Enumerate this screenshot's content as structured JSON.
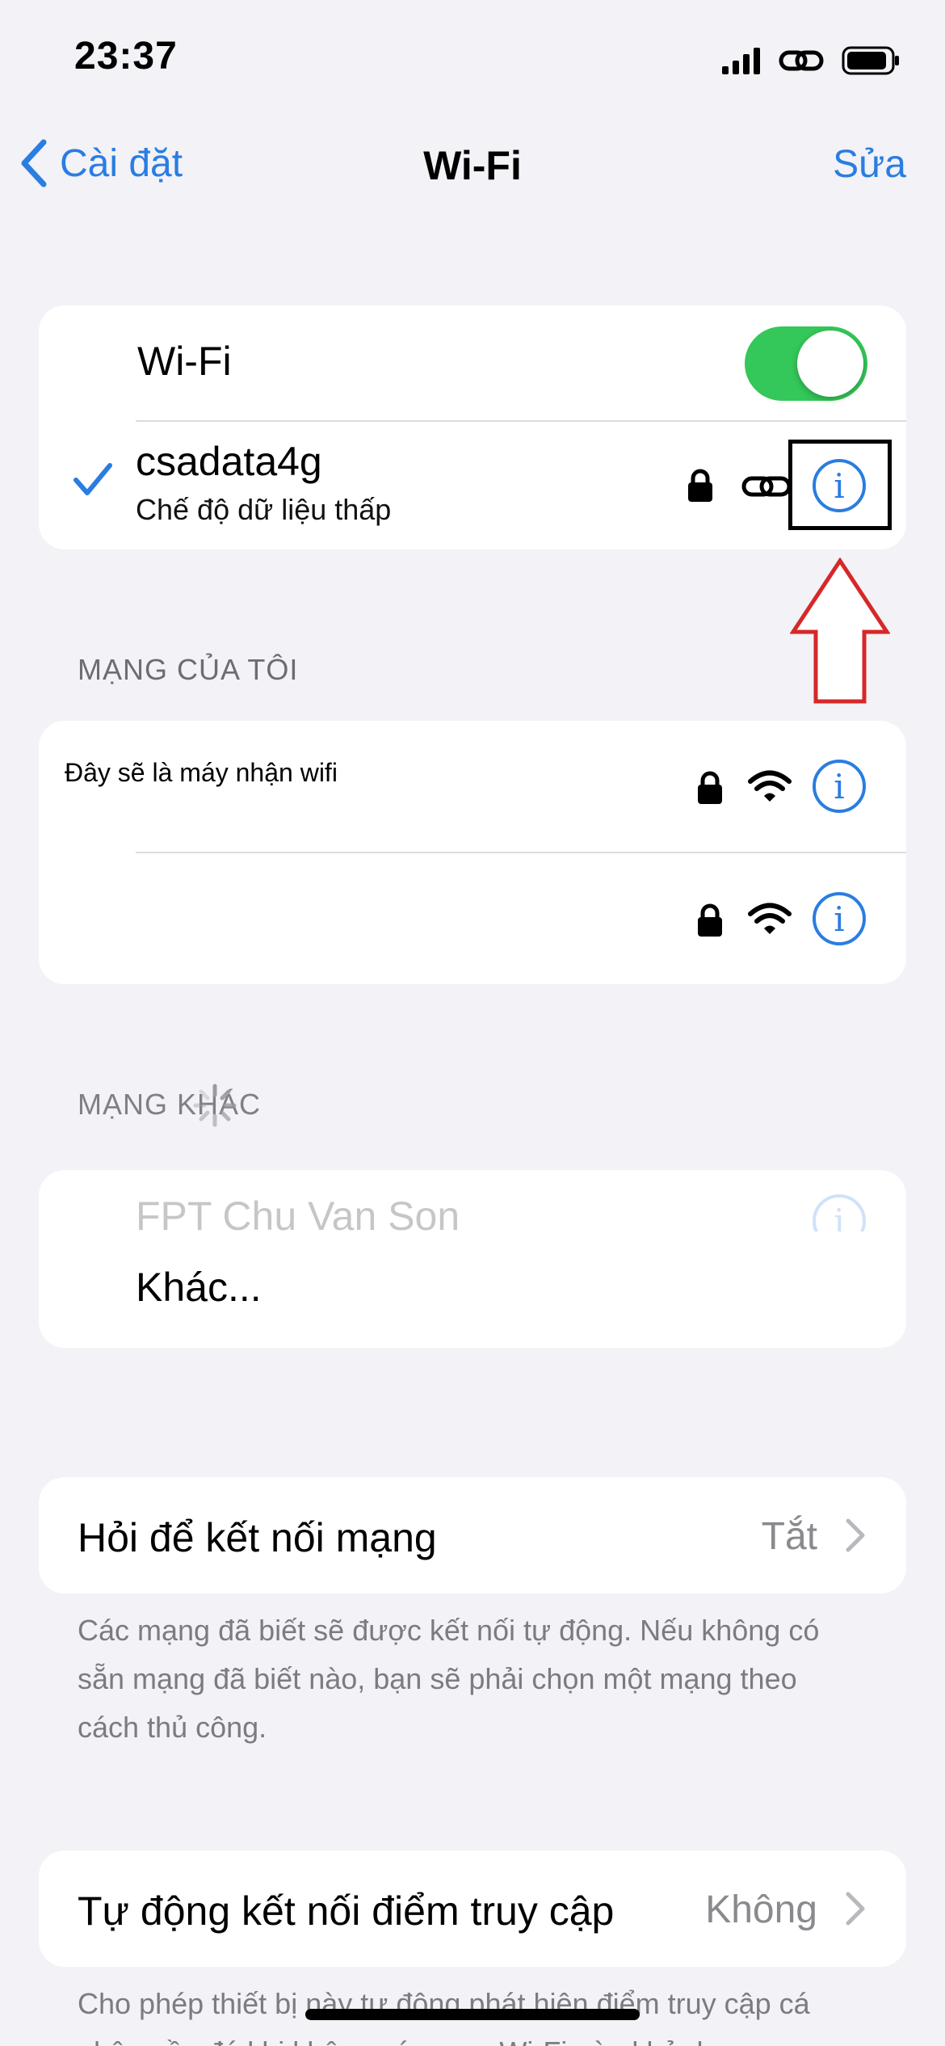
{
  "status_bar": {
    "time": "23:37"
  },
  "nav": {
    "back_label": "Cài đặt",
    "title": "Wi-Fi",
    "edit_label": "Sửa"
  },
  "wifi_card": {
    "toggle_label": "Wi-Fi",
    "toggle_on": true,
    "connected": {
      "name": "csadata4g",
      "subtitle": "Chế độ dữ liệu thấp"
    }
  },
  "my_networks": {
    "header": "MẠNG CỦA TÔI",
    "items": [
      {
        "name": "Đây sẽ là máy nhận wifi"
      },
      {
        "name": ""
      }
    ]
  },
  "other_networks": {
    "header": "MẠNG KHÁC",
    "faded_item": "FPT Chu Van Son",
    "other_label": "Khác..."
  },
  "ask_join": {
    "label": "Hỏi để kết nối mạng",
    "value": "Tắt",
    "footer": "Các mạng đã biết sẽ được kết nối tự động. Nếu không có sẵn mạng đã biết nào, bạn sẽ phải chọn một mạng theo cách thủ công."
  },
  "auto_join": {
    "label": "Tự động kết nối điểm truy cập",
    "value": "Không",
    "footer": "Cho phép thiết bị này tự động phát hiện điểm truy cập cá nhân gần đó khi không có mạng Wi-Fi nào khả dụng."
  },
  "colors": {
    "accent": "#2a7de1",
    "toggle_on": "#34c759",
    "annotation_arrow": "#d62828",
    "annotation_box": "#000000"
  }
}
